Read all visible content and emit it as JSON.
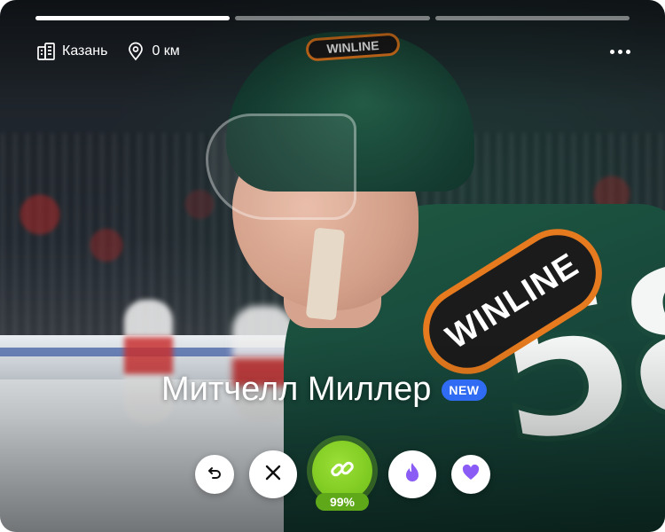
{
  "story": {
    "segments": [
      {
        "active": true
      },
      {
        "active": false
      },
      {
        "active": false
      }
    ]
  },
  "location": {
    "city": "Казань",
    "distance": "0 км",
    "city_icon": "buildings-icon",
    "distance_icon": "location-pin-icon"
  },
  "menu": {
    "icon": "more-dots-icon"
  },
  "profile": {
    "name": "Митчелл Миллер",
    "badge": "NEW"
  },
  "actions": {
    "rewind_icon": "undo-icon",
    "pass_icon": "close-icon",
    "match_icon": "link-icon",
    "match_percent": "99%",
    "super_icon": "flame-icon",
    "like_icon": "heart-icon"
  },
  "colors": {
    "accent_green": "#7cc820",
    "badge_blue": "#2f6cf3",
    "purple": "#8a5cf5"
  }
}
